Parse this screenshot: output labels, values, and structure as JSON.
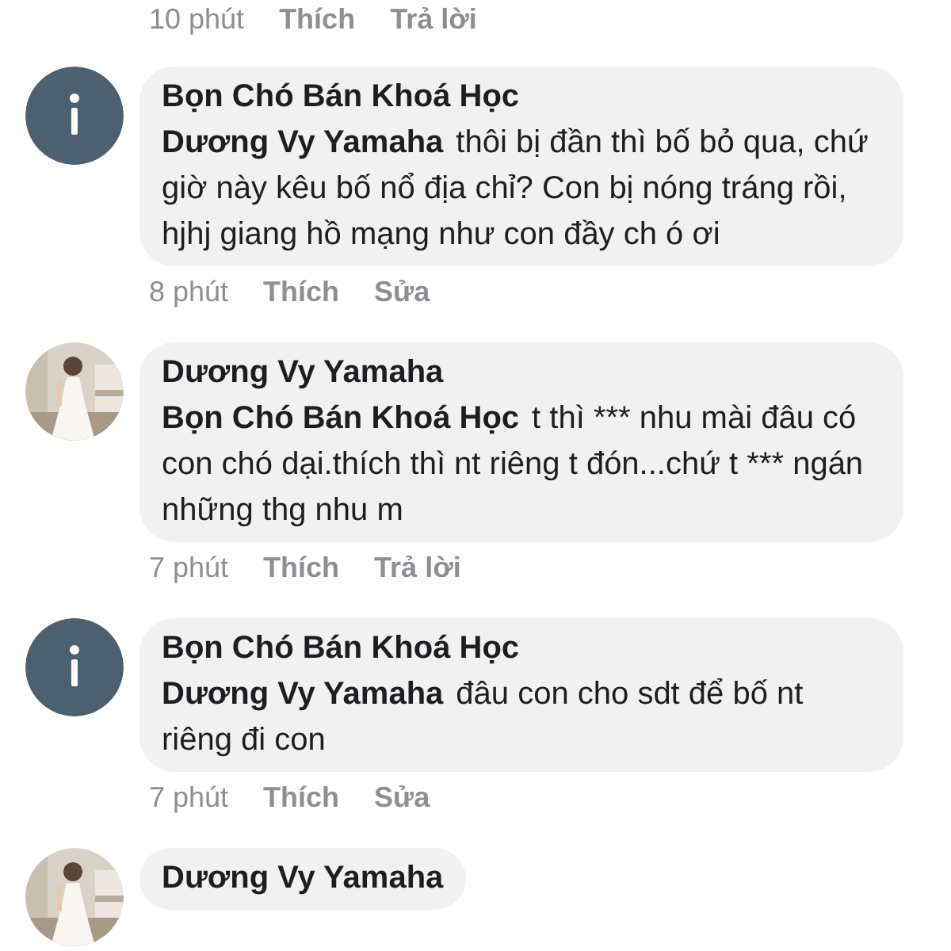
{
  "previous_comment_actions": {
    "time": "10 phút",
    "like": "Thích",
    "action": "Trả lời"
  },
  "comments": [
    {
      "avatar": {
        "kind": "info"
      },
      "author": "Bọn Chó Bán Khoá Học",
      "mention": "Dương Vy Yamaha",
      "text": "thôi bị đần thì bố bỏ qua, chứ giờ này kêu bố nổ địa chỉ? Con bị nóng tráng rồi, hjhj giang hồ mạng như con đầy ch ó ơi",
      "time": "8 phút",
      "like": "Thích",
      "action": "Sửa"
    },
    {
      "author": "Dương Vy Yamaha",
      "mention": "Bọn Chó Bán Khoá Học",
      "text": "t thì *** nhu mài đâu có con chó dại.thích thì nt riêng t đón...chứ t *** ngán những thg nhu m",
      "time": "7 phút",
      "like": "Thích",
      "action": "Trả lời"
    },
    {
      "avatar": {
        "kind": "info"
      },
      "author": "Bọn Chó Bán Khoá Học",
      "mention": "Dương Vy Yamaha",
      "text": "đâu con cho sdt để bố nt riêng đi con",
      "time": "7 phút",
      "like": "Thích",
      "action": "Sửa"
    },
    {
      "author": "Dương Vy Yamaha"
    }
  ]
}
